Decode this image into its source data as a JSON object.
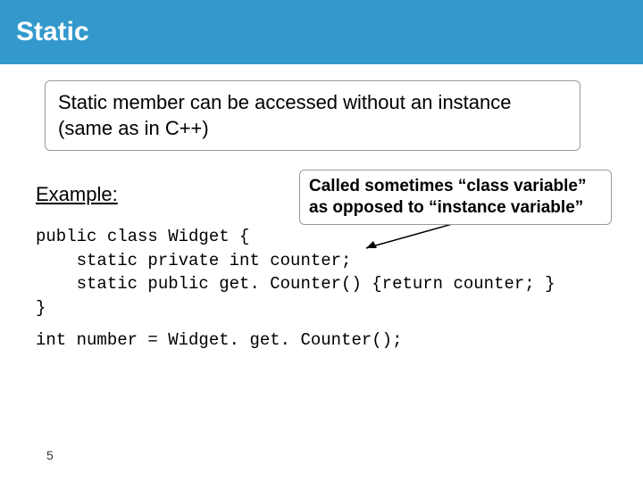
{
  "title": "Static",
  "main_box": "Static member can be accessed without an instance (same as in C++)",
  "example_label": "Example:",
  "callout_line1": "Called sometimes “class variable”",
  "callout_line2": "as opposed to “instance variable”",
  "code": {
    "l1": "public class Widget {",
    "l2": "    static private int counter;",
    "l3": "    static public get. Counter() {return counter; }",
    "l4": "}"
  },
  "code2": "int number = Widget. get. Counter();",
  "page_number": "5",
  "chart_data": null
}
